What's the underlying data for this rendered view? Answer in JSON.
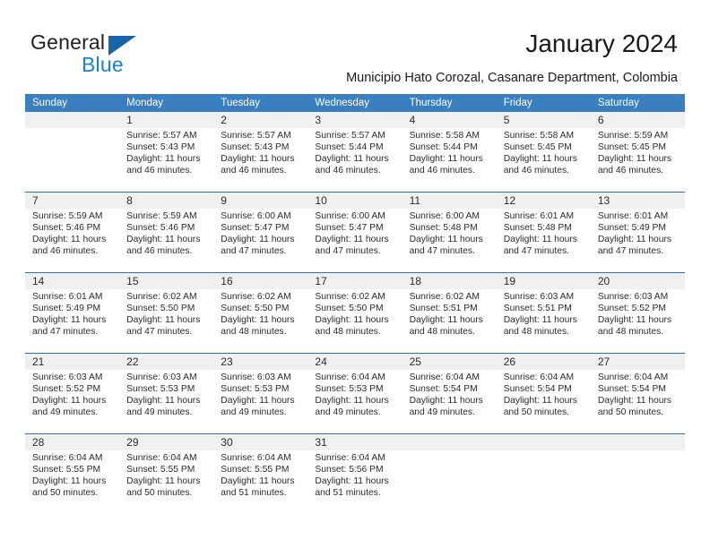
{
  "brand": {
    "name_part1": "General",
    "name_part2": "Blue",
    "triangle_icon": "triangle-icon",
    "color_dark": "#231f20",
    "color_blue": "#1b7fd4"
  },
  "header": {
    "title": "January 2024",
    "subtitle": "Municipio Hato Corozal, Casanare Department, Colombia"
  },
  "calendar": {
    "accent_color": "#3a7fbf",
    "weekdays": [
      "Sunday",
      "Monday",
      "Tuesday",
      "Wednesday",
      "Thursday",
      "Friday",
      "Saturday"
    ],
    "weeks": [
      [
        {
          "day": "",
          "sunrise": "",
          "sunset": "",
          "daylight_line1": "",
          "daylight_line2": "",
          "empty": true
        },
        {
          "day": "1",
          "sunrise": "Sunrise: 5:57 AM",
          "sunset": "Sunset: 5:43 PM",
          "daylight_line1": "Daylight: 11 hours",
          "daylight_line2": "and 46 minutes."
        },
        {
          "day": "2",
          "sunrise": "Sunrise: 5:57 AM",
          "sunset": "Sunset: 5:43 PM",
          "daylight_line1": "Daylight: 11 hours",
          "daylight_line2": "and 46 minutes."
        },
        {
          "day": "3",
          "sunrise": "Sunrise: 5:57 AM",
          "sunset": "Sunset: 5:44 PM",
          "daylight_line1": "Daylight: 11 hours",
          "daylight_line2": "and 46 minutes."
        },
        {
          "day": "4",
          "sunrise": "Sunrise: 5:58 AM",
          "sunset": "Sunset: 5:44 PM",
          "daylight_line1": "Daylight: 11 hours",
          "daylight_line2": "and 46 minutes."
        },
        {
          "day": "5",
          "sunrise": "Sunrise: 5:58 AM",
          "sunset": "Sunset: 5:45 PM",
          "daylight_line1": "Daylight: 11 hours",
          "daylight_line2": "and 46 minutes."
        },
        {
          "day": "6",
          "sunrise": "Sunrise: 5:59 AM",
          "sunset": "Sunset: 5:45 PM",
          "daylight_line1": "Daylight: 11 hours",
          "daylight_line2": "and 46 minutes."
        }
      ],
      [
        {
          "day": "7",
          "sunrise": "Sunrise: 5:59 AM",
          "sunset": "Sunset: 5:46 PM",
          "daylight_line1": "Daylight: 11 hours",
          "daylight_line2": "and 46 minutes."
        },
        {
          "day": "8",
          "sunrise": "Sunrise: 5:59 AM",
          "sunset": "Sunset: 5:46 PM",
          "daylight_line1": "Daylight: 11 hours",
          "daylight_line2": "and 46 minutes."
        },
        {
          "day": "9",
          "sunrise": "Sunrise: 6:00 AM",
          "sunset": "Sunset: 5:47 PM",
          "daylight_line1": "Daylight: 11 hours",
          "daylight_line2": "and 47 minutes."
        },
        {
          "day": "10",
          "sunrise": "Sunrise: 6:00 AM",
          "sunset": "Sunset: 5:47 PM",
          "daylight_line1": "Daylight: 11 hours",
          "daylight_line2": "and 47 minutes."
        },
        {
          "day": "11",
          "sunrise": "Sunrise: 6:00 AM",
          "sunset": "Sunset: 5:48 PM",
          "daylight_line1": "Daylight: 11 hours",
          "daylight_line2": "and 47 minutes."
        },
        {
          "day": "12",
          "sunrise": "Sunrise: 6:01 AM",
          "sunset": "Sunset: 5:48 PM",
          "daylight_line1": "Daylight: 11 hours",
          "daylight_line2": "and 47 minutes."
        },
        {
          "day": "13",
          "sunrise": "Sunrise: 6:01 AM",
          "sunset": "Sunset: 5:49 PM",
          "daylight_line1": "Daylight: 11 hours",
          "daylight_line2": "and 47 minutes."
        }
      ],
      [
        {
          "day": "14",
          "sunrise": "Sunrise: 6:01 AM",
          "sunset": "Sunset: 5:49 PM",
          "daylight_line1": "Daylight: 11 hours",
          "daylight_line2": "and 47 minutes."
        },
        {
          "day": "15",
          "sunrise": "Sunrise: 6:02 AM",
          "sunset": "Sunset: 5:50 PM",
          "daylight_line1": "Daylight: 11 hours",
          "daylight_line2": "and 47 minutes."
        },
        {
          "day": "16",
          "sunrise": "Sunrise: 6:02 AM",
          "sunset": "Sunset: 5:50 PM",
          "daylight_line1": "Daylight: 11 hours",
          "daylight_line2": "and 48 minutes."
        },
        {
          "day": "17",
          "sunrise": "Sunrise: 6:02 AM",
          "sunset": "Sunset: 5:50 PM",
          "daylight_line1": "Daylight: 11 hours",
          "daylight_line2": "and 48 minutes."
        },
        {
          "day": "18",
          "sunrise": "Sunrise: 6:02 AM",
          "sunset": "Sunset: 5:51 PM",
          "daylight_line1": "Daylight: 11 hours",
          "daylight_line2": "and 48 minutes."
        },
        {
          "day": "19",
          "sunrise": "Sunrise: 6:03 AM",
          "sunset": "Sunset: 5:51 PM",
          "daylight_line1": "Daylight: 11 hours",
          "daylight_line2": "and 48 minutes."
        },
        {
          "day": "20",
          "sunrise": "Sunrise: 6:03 AM",
          "sunset": "Sunset: 5:52 PM",
          "daylight_line1": "Daylight: 11 hours",
          "daylight_line2": "and 48 minutes."
        }
      ],
      [
        {
          "day": "21",
          "sunrise": "Sunrise: 6:03 AM",
          "sunset": "Sunset: 5:52 PM",
          "daylight_line1": "Daylight: 11 hours",
          "daylight_line2": "and 49 minutes."
        },
        {
          "day": "22",
          "sunrise": "Sunrise: 6:03 AM",
          "sunset": "Sunset: 5:53 PM",
          "daylight_line1": "Daylight: 11 hours",
          "daylight_line2": "and 49 minutes."
        },
        {
          "day": "23",
          "sunrise": "Sunrise: 6:03 AM",
          "sunset": "Sunset: 5:53 PM",
          "daylight_line1": "Daylight: 11 hours",
          "daylight_line2": "and 49 minutes."
        },
        {
          "day": "24",
          "sunrise": "Sunrise: 6:04 AM",
          "sunset": "Sunset: 5:53 PM",
          "daylight_line1": "Daylight: 11 hours",
          "daylight_line2": "and 49 minutes."
        },
        {
          "day": "25",
          "sunrise": "Sunrise: 6:04 AM",
          "sunset": "Sunset: 5:54 PM",
          "daylight_line1": "Daylight: 11 hours",
          "daylight_line2": "and 49 minutes."
        },
        {
          "day": "26",
          "sunrise": "Sunrise: 6:04 AM",
          "sunset": "Sunset: 5:54 PM",
          "daylight_line1": "Daylight: 11 hours",
          "daylight_line2": "and 50 minutes."
        },
        {
          "day": "27",
          "sunrise": "Sunrise: 6:04 AM",
          "sunset": "Sunset: 5:54 PM",
          "daylight_line1": "Daylight: 11 hours",
          "daylight_line2": "and 50 minutes."
        }
      ],
      [
        {
          "day": "28",
          "sunrise": "Sunrise: 6:04 AM",
          "sunset": "Sunset: 5:55 PM",
          "daylight_line1": "Daylight: 11 hours",
          "daylight_line2": "and 50 minutes."
        },
        {
          "day": "29",
          "sunrise": "Sunrise: 6:04 AM",
          "sunset": "Sunset: 5:55 PM",
          "daylight_line1": "Daylight: 11 hours",
          "daylight_line2": "and 50 minutes."
        },
        {
          "day": "30",
          "sunrise": "Sunrise: 6:04 AM",
          "sunset": "Sunset: 5:55 PM",
          "daylight_line1": "Daylight: 11 hours",
          "daylight_line2": "and 51 minutes."
        },
        {
          "day": "31",
          "sunrise": "Sunrise: 6:04 AM",
          "sunset": "Sunset: 5:56 PM",
          "daylight_line1": "Daylight: 11 hours",
          "daylight_line2": "and 51 minutes."
        },
        {
          "day": "",
          "sunrise": "",
          "sunset": "",
          "daylight_line1": "",
          "daylight_line2": "",
          "empty": true
        },
        {
          "day": "",
          "sunrise": "",
          "sunset": "",
          "daylight_line1": "",
          "daylight_line2": "",
          "empty": true
        },
        {
          "day": "",
          "sunrise": "",
          "sunset": "",
          "daylight_line1": "",
          "daylight_line2": "",
          "empty": true
        }
      ]
    ]
  }
}
